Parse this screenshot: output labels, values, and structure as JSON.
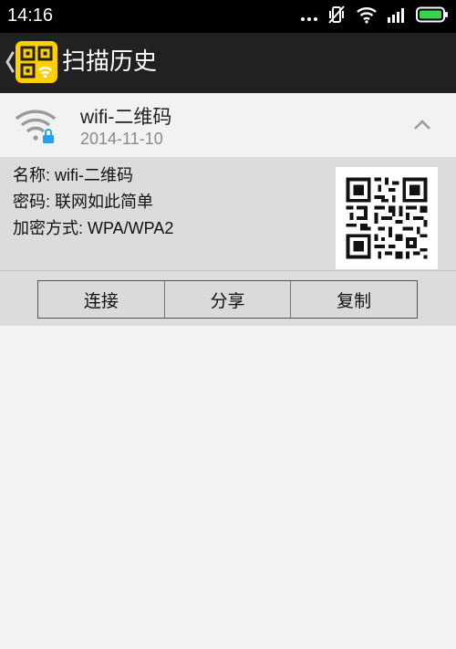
{
  "status_bar": {
    "time": "14:16"
  },
  "app_bar": {
    "title": "扫描历史"
  },
  "entry": {
    "name": "wifi-二维码",
    "date": "2014-11-10",
    "details": {
      "name_line": "名称: wifi-二维码",
      "password_line": "密码: 联网如此简单",
      "encryption_line": "加密方式: WPA/WPA2"
    }
  },
  "actions": {
    "connect": "连接",
    "share": "分享",
    "copy": "复制"
  },
  "colors": {
    "logo_bg": "#ffd000",
    "lock_accent": "#2b9fe6",
    "battery_green": "#39d353"
  }
}
